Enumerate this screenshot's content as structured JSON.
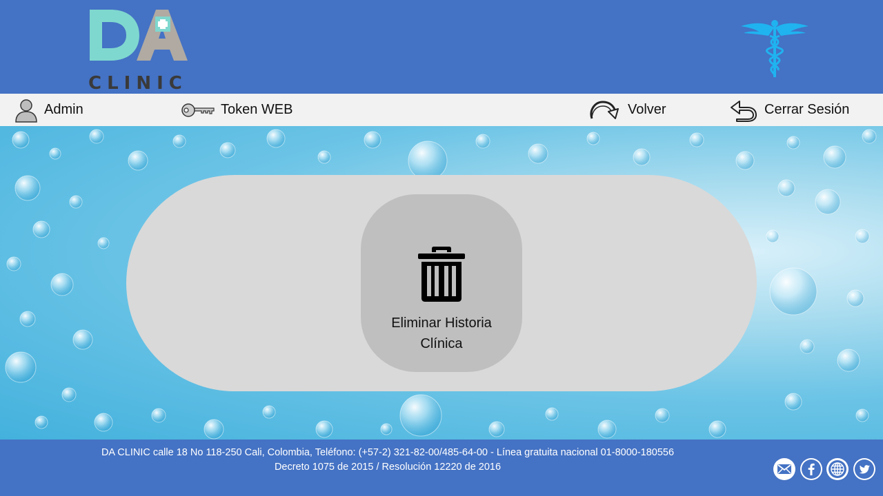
{
  "header": {
    "logo": {
      "letters": "DA",
      "subtitle": "CLINIC",
      "teal": "#7fd8cf",
      "gray": "#b0aaa2",
      "dark": "#3a3a3a"
    },
    "emblem_icon": "caduceus-icon",
    "emblem_color": "#1fb3f0"
  },
  "nav": {
    "admin": {
      "label": "Admin",
      "icon": "user-icon"
    },
    "token": {
      "label": "Token WEB",
      "icon": "key-icon"
    },
    "volver": {
      "label": "Volver",
      "icon": "redo-arrow-icon"
    },
    "logout": {
      "label": "Cerrar Sesión",
      "icon": "return-arrow-icon"
    }
  },
  "main": {
    "background": "water-droplets",
    "actions": [
      {
        "label_line1": "Eliminar Historia",
        "label_line2": "Clínica",
        "icon": "trash-icon"
      }
    ]
  },
  "footer": {
    "line1": "DA CLINIC calle 18 No 118-250 Cali, Colombia, Teléfono: (+57-2) 321-82-00/485-64-00 - Línea gratuita nacional 01-8000-180556",
    "line2": "Decreto 1075 de 2015 / Resolución 12220 de 2016",
    "social": [
      "mail-icon",
      "facebook-icon",
      "globe-icon",
      "twitter-icon"
    ],
    "social_color": "#4472c4"
  },
  "colors": {
    "brand_blue": "#4472c4",
    "navbar": "#f2f2f2",
    "panel": "#d9d9d9",
    "card": "#bfbfbf"
  }
}
